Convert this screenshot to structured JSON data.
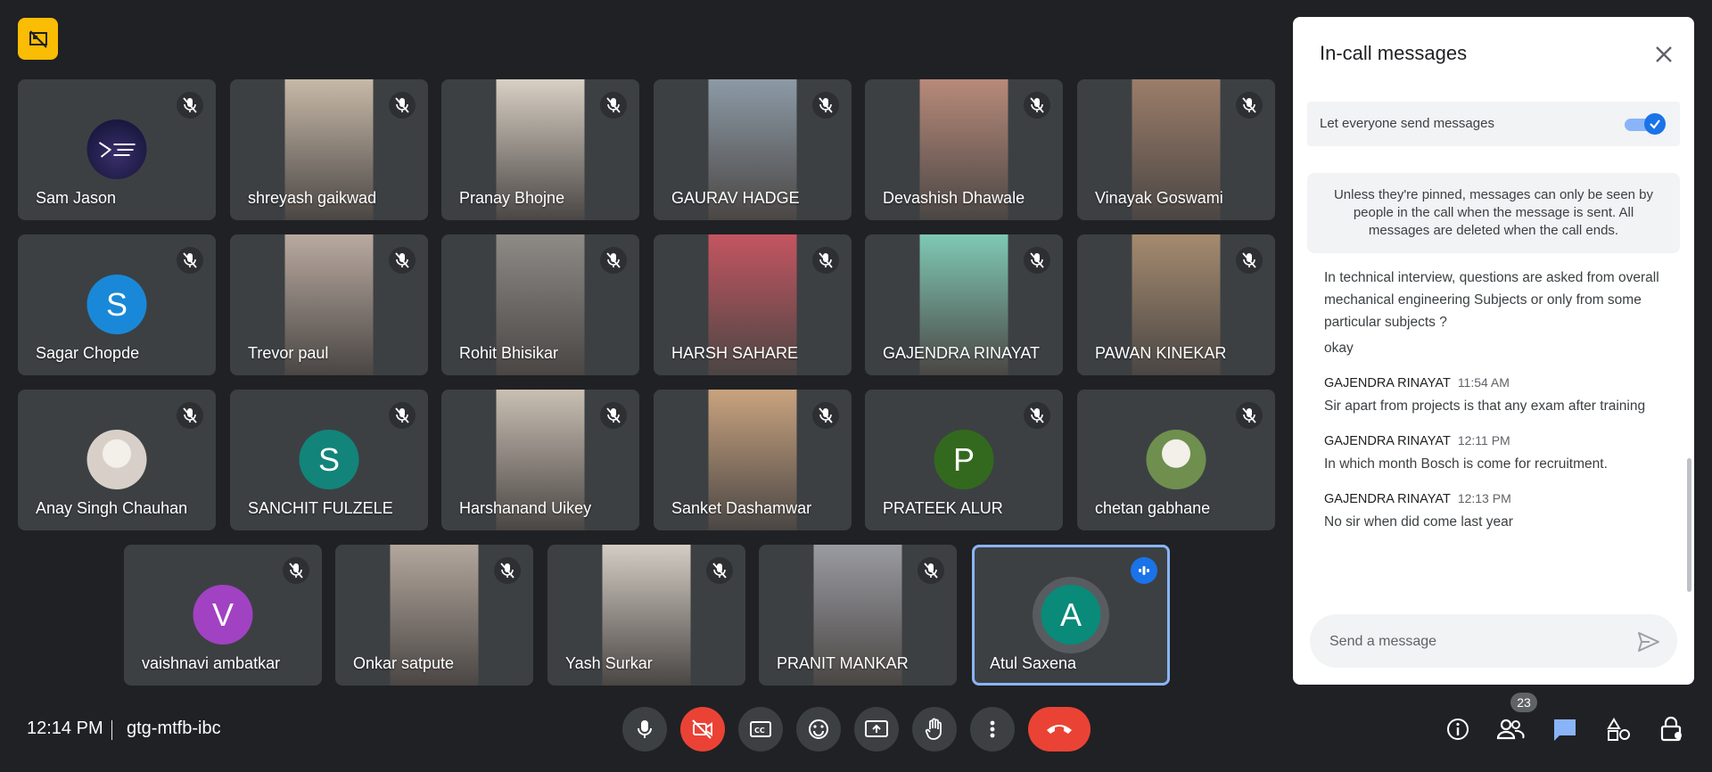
{
  "participants": [
    {
      "name": "Sam Jason",
      "avatar": "logo",
      "bg": "#3c4043"
    },
    {
      "name": "shreyash gaikwad",
      "video": "#c7b9a8"
    },
    {
      "name": "Pranay Bhojne",
      "video": "#d8d0c4"
    },
    {
      "name": "GAURAV HADGE",
      "video": "#8c9aa6"
    },
    {
      "name": "Devashish Dhawale",
      "video": "#b88a7a"
    },
    {
      "name": "Vinayak Goswami",
      "video": "#9c7d6a"
    },
    {
      "name": "Sagar Chopde",
      "avatar": "S",
      "color": "#1a88d8"
    },
    {
      "name": "Trevor paul",
      "video": "#b9aaa0"
    },
    {
      "name": "Rohit Bhisikar",
      "video": "#8e8a86"
    },
    {
      "name": "HARSH SAHARE",
      "video": "#c45560"
    },
    {
      "name": "GAJENDRA RINAYAT",
      "video": "#7fc9b4"
    },
    {
      "name": "PAWAN KINEKAR",
      "video": "#a58b6f"
    },
    {
      "name": "Anay Singh Chauhan",
      "avatar": "photo",
      "color": "#d8d0c8"
    },
    {
      "name": "SANCHIT FULZELE",
      "avatar": "S",
      "color": "#12847a"
    },
    {
      "name": "Harshanand Uikey",
      "video": "#c9bfb3"
    },
    {
      "name": "Sanket Dashamwar",
      "video": "#c9a37f"
    },
    {
      "name": "PRATEEK ALUR",
      "avatar": "P",
      "color": "#33691e"
    },
    {
      "name": "chetan gabhane",
      "avatar": "photo",
      "color": "#6f8f4e"
    },
    {
      "name": "vaishnavi ambatkar",
      "avatar": "V",
      "color": "#a142c2"
    },
    {
      "name": "Onkar satpute",
      "video": "#b3a79d"
    },
    {
      "name": "Yash Surkar",
      "video": "#d4cdc4"
    },
    {
      "name": "PRANIT MANKAR",
      "video": "#9a9ba1"
    },
    {
      "name": "Atul Saxena",
      "avatar": "A",
      "color": "#0a8a79"
    }
  ],
  "panel": {
    "title": "In-call messages",
    "toggle_label": "Let everyone send messages",
    "notice": "Unless they're pinned, messages can only be seen by people in the call when the message is sent. All messages are deleted when the call ends.",
    "messages": [
      {
        "text": "In technical interview, questions are asked from overall mechanical engineering Subjects or only from some particular subjects ?"
      },
      {
        "text": "okay"
      },
      {
        "sender": "GAJENDRA RINAYAT",
        "time": "11:54 AM",
        "text": "Sir apart from projects is that any exam after training"
      },
      {
        "sender": "GAJENDRA RINAYAT",
        "time": "12:11 PM",
        "text": "In which month Bosch is come for recruitment."
      },
      {
        "sender": "GAJENDRA RINAYAT",
        "time": "12:13 PM",
        "text": "No sir when did  come last year"
      }
    ],
    "compose_placeholder": "Send a message"
  },
  "footer": {
    "time": "12:14 PM",
    "meeting_code": "gtg-mtfb-ibc",
    "participant_count": "23"
  }
}
